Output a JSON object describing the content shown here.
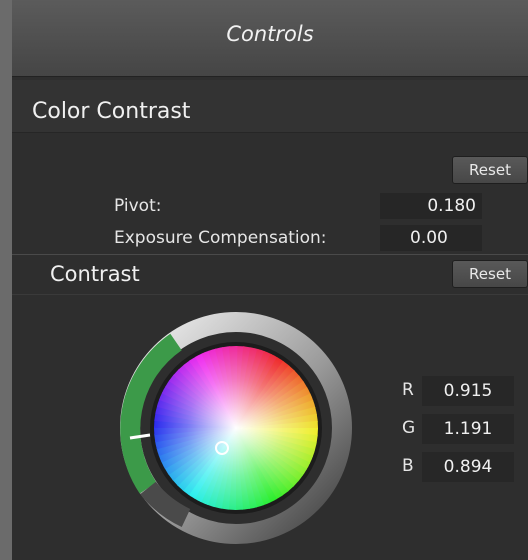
{
  "window": {
    "title": "Controls"
  },
  "color_contrast": {
    "heading": "Color Contrast",
    "reset_label": "Reset",
    "pivot": {
      "label": "Pivot:",
      "value": "0.180"
    },
    "exposure": {
      "label": "Exposure Compensation:",
      "value": "0.00"
    }
  },
  "contrast": {
    "heading": "Contrast",
    "reset_label": "Reset",
    "channels": [
      {
        "label": "R",
        "value": "0.915"
      },
      {
        "label": "G",
        "value": "1.191"
      },
      {
        "label": "B",
        "value": "0.894"
      }
    ]
  }
}
